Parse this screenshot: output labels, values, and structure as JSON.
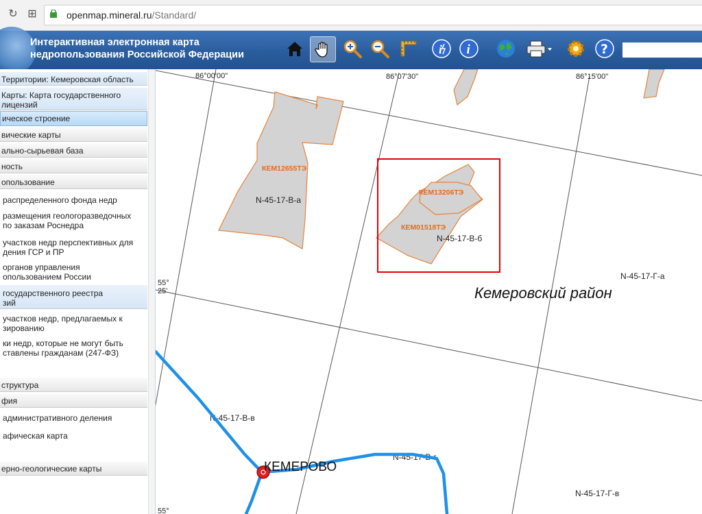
{
  "browser": {
    "url_host": "openmap.mineral.ru",
    "url_path": "/Standard/"
  },
  "app": {
    "title_line1": "Интерактивная электронная карта",
    "title_line2": "недропользования Российской Федерации"
  },
  "toolbar": {
    "buttons": [
      "home-icon",
      "pan-hand-icon",
      "zoom-in-icon",
      "zoom-out-icon",
      "ruler-icon",
      "info-lightning-icon",
      "info-icon",
      "globe-icon",
      "print-icon",
      "settings-gear-icon",
      "help-icon"
    ]
  },
  "sidebar": {
    "rows": [
      {
        "label": "Территории: Кемеровская область",
        "type": "head-blue"
      },
      {
        "label": "Карты: Карта государственного",
        "label2": "лицензий",
        "type": "head-blue"
      },
      {
        "label": "ическое строение",
        "type": "head-sel"
      },
      {
        "label": "вические карты",
        "type": "head"
      },
      {
        "label": "ально-сырьевая база",
        "type": "head"
      },
      {
        "label": "ность",
        "type": "head"
      },
      {
        "label": "опользование",
        "type": "head"
      },
      {
        "label": "распределенного фонда недр",
        "type": "item"
      },
      {
        "label": "размещения геологоразведочных",
        "label2": "по заказам Роснедра",
        "type": "item"
      },
      {
        "label": "участков недр перспективных для",
        "label2": "дения ГСР и ПР",
        "type": "item"
      },
      {
        "label": "органов управления",
        "label2": "опользованием России",
        "type": "item"
      },
      {
        "label": "государственного реестра",
        "label2": "зий",
        "type": "head-blue"
      },
      {
        "label": "участков недр, предлагаемых к",
        "label2": "зированию",
        "type": "item"
      },
      {
        "label": "ки недр, которые не могут быть",
        "label2": "ставлены гражданам (247-ФЗ)",
        "type": "item"
      },
      {
        "label": "структура",
        "type": "head"
      },
      {
        "label": "фия",
        "type": "head"
      },
      {
        "label": "административного деления",
        "type": "item"
      },
      {
        "label": "афическая карта",
        "type": "item"
      },
      {
        "label": "ерно-геологические карты",
        "type": "head"
      }
    ]
  },
  "map": {
    "lon_labels": [
      "86°00'00\"",
      "86°07'30\"",
      "86°15'00\""
    ],
    "lat_label_top": "55°",
    "lat_label_25": "25'",
    "lat_label_bottom": "55°",
    "sheet_labels": [
      "N-45-17-В-а",
      "N-45-17-В-б",
      "N-45-17-Г-а",
      "N-45-17-В-в",
      "N-45-17-В-г",
      "N-45-17-Г-в"
    ],
    "license_labels": [
      "КЕМ12655ТЭ",
      "КЕМ13206ТЭ",
      "КЕМ01518ТЭ"
    ],
    "district_label": "Кемеровский район",
    "city_label": "КЕМЕРОВО",
    "colors": {
      "license_fill": "#d3d3d3",
      "license_stroke": "#e8823a",
      "license_text": "#e86a1a",
      "highlight_box": "#e00000",
      "road": "#1e90e8",
      "city_marker": "#e02020"
    }
  }
}
